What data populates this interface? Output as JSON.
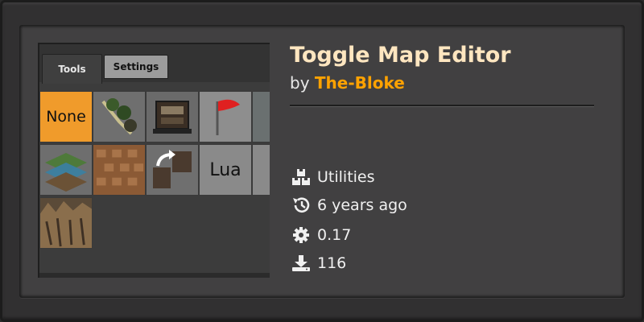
{
  "mod": {
    "title": "Toggle Map Editor",
    "by_prefix": "by",
    "author": "The-Bloke"
  },
  "thumbnail": {
    "tabs": [
      {
        "label": "Tools"
      },
      {
        "label": "Settings"
      }
    ],
    "cells": [
      {
        "label": "None",
        "icon": "none-text"
      },
      {
        "label": "",
        "icon": "tree-icon"
      },
      {
        "label": "",
        "icon": "entity-icon"
      },
      {
        "label": "",
        "icon": "red-flag-icon"
      },
      {
        "label": "",
        "icon": "layers-icon"
      },
      {
        "label": "",
        "icon": "tiles-icon"
      },
      {
        "label": "",
        "icon": "clone-arrow-icon"
      },
      {
        "label": "Lua",
        "icon": "lua-text"
      },
      {
        "label": "",
        "icon": "cliff-icon"
      }
    ]
  },
  "meta": {
    "category": {
      "icon": "boxes-icon",
      "text": "Utilities"
    },
    "updated": {
      "icon": "history-icon",
      "text": "6 years ago"
    },
    "version": {
      "icon": "gear-icon",
      "text": "0.17"
    },
    "downloads": {
      "icon": "download-icon",
      "text": "116"
    }
  },
  "colors": {
    "title": "#ffe6c0",
    "author": "#ffa200",
    "panel_bg": "#414041",
    "accent_orange": "#f09b2b"
  }
}
